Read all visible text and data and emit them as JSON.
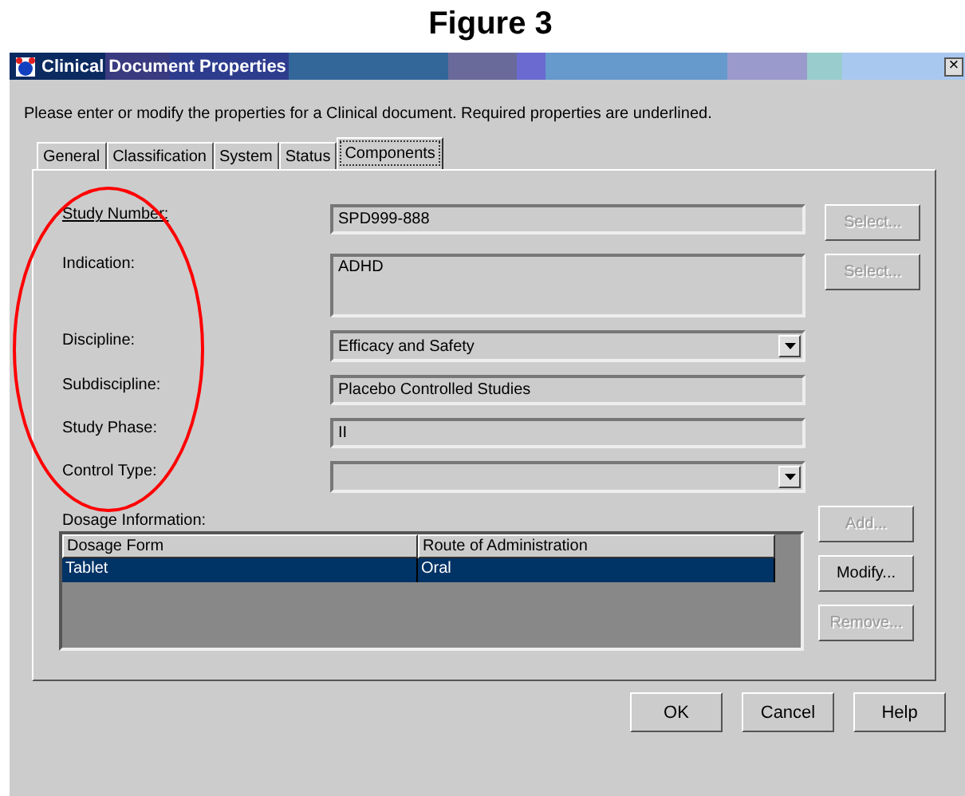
{
  "caption": "Figure 3",
  "window": {
    "title": "Clinical Document Properties",
    "close": "×"
  },
  "instructions": "Please enter or modify the properties for a Clinical document.  Required properties are underlined.",
  "tabs": [
    {
      "label": "General",
      "selected": false
    },
    {
      "label": "Classification",
      "selected": false
    },
    {
      "label": "System",
      "selected": false
    },
    {
      "label": "Status",
      "selected": false
    },
    {
      "label": "Components",
      "selected": true
    }
  ],
  "fields": [
    {
      "kind": "text",
      "label": "Study Number:",
      "required": true,
      "value": "SPD999-888",
      "button": {
        "label": "Select...",
        "disabled": true
      }
    },
    {
      "kind": "textarea",
      "label": "Indication:",
      "required": false,
      "value": "ADHD",
      "button": {
        "label": "Select...",
        "disabled": true
      }
    },
    {
      "kind": "dropdown",
      "label": "Discipline:",
      "required": false,
      "value": "Efficacy and Safety"
    },
    {
      "kind": "text",
      "label": "Subdiscipline:",
      "required": false,
      "value": "Placebo Controlled Studies"
    },
    {
      "kind": "text",
      "label": "Study Phase:",
      "required": false,
      "value": "II"
    },
    {
      "kind": "dropdown",
      "label": "Control Type:",
      "required": false
    }
  ],
  "dosage": {
    "label": "Dosage Information:",
    "columns": [
      "Dosage Form",
      "Route of Administration"
    ],
    "rows": [
      {
        "cells": [
          "Tablet",
          "Oral"
        ],
        "selected": true
      }
    ],
    "buttons": [
      {
        "label": "Add...",
        "disabled": true
      },
      {
        "label": "Modify...",
        "disabled": false
      },
      {
        "label": "Remove...",
        "disabled": true
      }
    ]
  },
  "buttons": [
    "OK",
    "Cancel",
    "Help"
  ],
  "annotation": {
    "kind": "ellipse",
    "color": "#ff0000"
  }
}
